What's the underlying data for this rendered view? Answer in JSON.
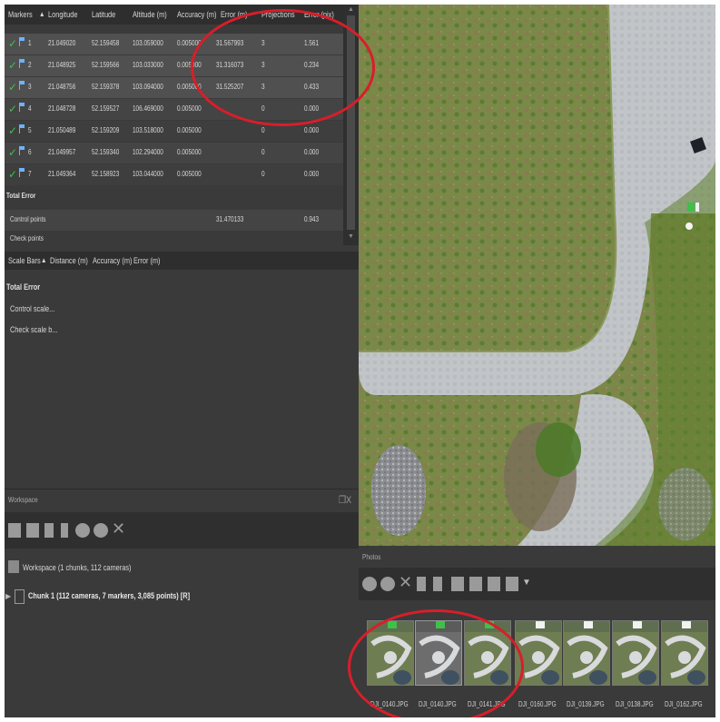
{
  "markers": {
    "headers": [
      "Markers",
      "Longitude",
      "Latitude",
      "Altitude (m)",
      "Accuracy (m)",
      "Error (m)",
      "Projections",
      "Error (pix)"
    ],
    "rows": [
      {
        "name": "1",
        "lon": "21.049020",
        "lat": "52.159458",
        "alt": "103.059000",
        "acc": "0.005000",
        "err_m": "31.567993",
        "proj": "3",
        "err_pix": "1.561"
      },
      {
        "name": "2",
        "lon": "21.048925",
        "lat": "52.159566",
        "alt": "103.033000",
        "acc": "0.005000",
        "err_m": "31.316073",
        "proj": "3",
        "err_pix": "0.234"
      },
      {
        "name": "3",
        "lon": "21.048756",
        "lat": "52.159378",
        "alt": "103.094000",
        "acc": "0.005000",
        "err_m": "31.525207",
        "proj": "3",
        "err_pix": "0.433"
      },
      {
        "name": "4",
        "lon": "21.048728",
        "lat": "52.159527",
        "alt": "106.469000",
        "acc": "0.005000",
        "err_m": "",
        "proj": "0",
        "err_pix": "0.000"
      },
      {
        "name": "5",
        "lon": "21.050489",
        "lat": "52.159209",
        "alt": "103.518000",
        "acc": "0.005000",
        "err_m": "",
        "proj": "0",
        "err_pix": "0.000"
      },
      {
        "name": "6",
        "lon": "21.049957",
        "lat": "52.159340",
        "alt": "102.294000",
        "acc": "0.005000",
        "err_m": "",
        "proj": "0",
        "err_pix": "0.000"
      },
      {
        "name": "7",
        "lon": "21.049364",
        "lat": "52.158923",
        "alt": "103.044000",
        "acc": "0.005000",
        "err_m": "",
        "proj": "0",
        "err_pix": "0.000"
      }
    ],
    "total_error_label": "Total Error",
    "control_points_label": "Control points",
    "control_points_err_m": "31.470133",
    "control_points_err_pix": "0.943",
    "check_points_label": "Check points"
  },
  "scale_bars": {
    "headers": [
      "Scale Bars",
      "Distance (m)",
      "Accuracy (m)",
      "Error (m)"
    ],
    "total_error_label": "Total Error",
    "control_label": "Control scale...",
    "check_label": "Check scale b..."
  },
  "workspace": {
    "title": "Workspace",
    "window_controls": "❐X",
    "root_label": "Workspace (1 chunks, 112 cameras)",
    "chunk_label": "Chunk 1 (112 cameras, 7 markers, 3,085 points) [R]"
  },
  "photos": {
    "title": "Photos",
    "items": [
      {
        "label": "DJI_0140.JPG",
        "flag": "green"
      },
      {
        "label": "DJI_0140.JPG",
        "flag": "green"
      },
      {
        "label": "DJI_0141.JPG",
        "flag": "green"
      },
      {
        "label": "DJI_0160.JPG",
        "flag": "white"
      },
      {
        "label": "DJI_0139.JPG",
        "flag": "white"
      },
      {
        "label": "DJI_0138.JPG",
        "flag": "white"
      },
      {
        "label": "DJI_0162.JPG",
        "flag": "white"
      }
    ]
  },
  "colors": {
    "annotation": "#d81e2a",
    "check": "#3ec04a",
    "flag_blue": "#6ab4ff"
  }
}
